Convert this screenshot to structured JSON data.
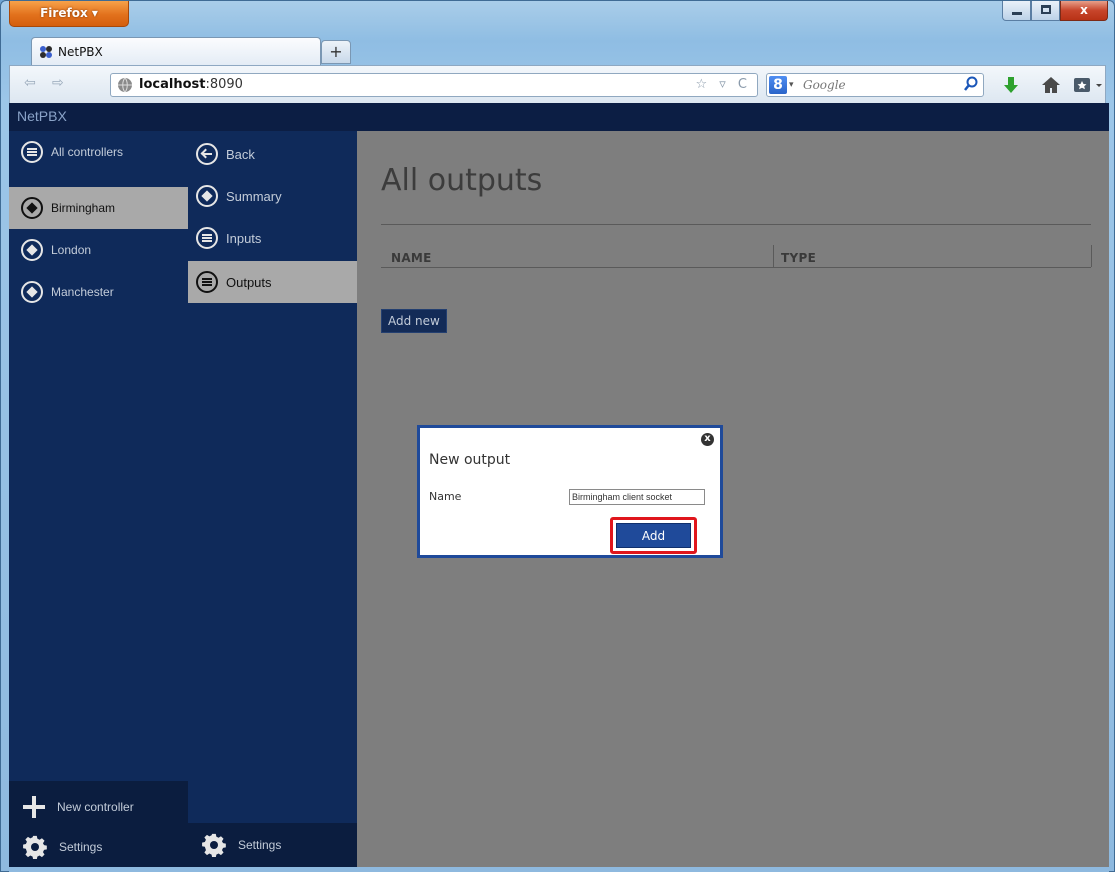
{
  "browser": {
    "menu_button": "Firefox ▾",
    "close_glyph": "x",
    "tab_title": "NetPBX",
    "new_tab": "+",
    "url_host": "localhost",
    "url_port": ":8090",
    "search_placeholder": "Google",
    "nav_icons": "☆ ▿ C"
  },
  "app": {
    "title": "NetPBX",
    "controllers": [
      {
        "label": "All controllers"
      },
      {
        "label": "Birmingham"
      },
      {
        "label": "London"
      },
      {
        "label": "Manchester"
      }
    ],
    "sub_nav": [
      {
        "label": "Back"
      },
      {
        "label": "Summary"
      },
      {
        "label": "Inputs"
      },
      {
        "label": "Outputs"
      }
    ],
    "new_controller": "New controller",
    "settings": "Settings",
    "settings2": "Settings"
  },
  "main": {
    "title": "All outputs",
    "columns": [
      "NAME",
      "TYPE"
    ],
    "add_new": "Add new"
  },
  "modal": {
    "title": "New output",
    "name_label": "Name",
    "name_value": "Birmingham client socket",
    "add_button": "Add",
    "close_glyph": "x"
  },
  "colors": {
    "accent": "#1f4a9a",
    "sidebar": "#0f2a5a",
    "highlight": "#e0161c",
    "overlay": "#7e7e7e"
  }
}
